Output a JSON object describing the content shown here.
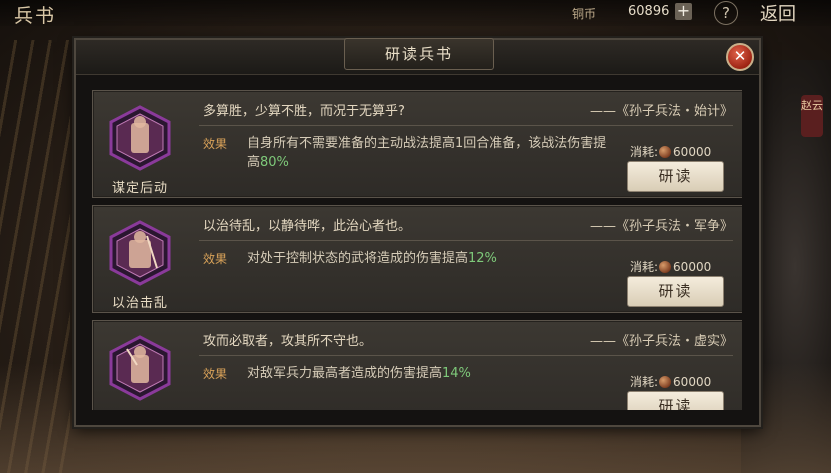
{
  "topbar": {
    "title": "兵书",
    "currency_label": "铜币",
    "currency_value": "60896",
    "plus_label": "+",
    "help_label": "?",
    "back_label": "返回"
  },
  "side_tag": "赵云",
  "dialog": {
    "title": "研读兵书",
    "close_label": "✕"
  },
  "cards": [
    {
      "name": "谋定后动",
      "quote": "多算胜，少算不胜，而况于无算乎?",
      "source": "——《孙子兵法・始计》",
      "effect_label": "效果",
      "effect_text": "自身所有不需要准备的主动战法提高1回合准备，该战法伤害提高",
      "effect_pct": "80%",
      "cost_label": "消耗:",
      "cost_value": "60000",
      "button": "研读"
    },
    {
      "name": "以治击乱",
      "quote": "以治待乱，以静待哗，此治心者也。",
      "source": "——《孙子兵法・军争》",
      "effect_label": "效果",
      "effect_text": "对处于控制状态的武将造成的伤害提高",
      "effect_pct": "12%",
      "cost_label": "消耗:",
      "cost_value": "60000",
      "button": "研读"
    },
    {
      "name": "",
      "quote": "攻而必取者，攻其所不守也。",
      "source": "——《孙子兵法・虚实》",
      "effect_label": "效果",
      "effect_text": "对敌军兵力最高者造成的伤害提高",
      "effect_pct": "14%",
      "cost_label": "消耗:",
      "cost_value": "60000",
      "button": "研读"
    }
  ],
  "colors": {
    "accent_orange": "#d9a259",
    "percent_green": "#7ec97a",
    "emblem_purple": "#8a3a9a"
  }
}
